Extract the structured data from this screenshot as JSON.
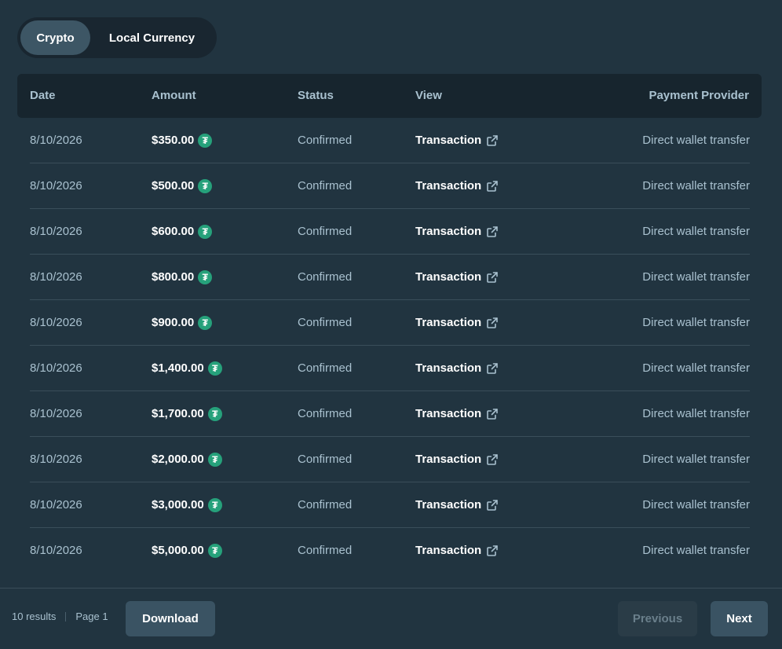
{
  "tabs": {
    "crypto": "Crypto",
    "local": "Local Currency"
  },
  "columns": {
    "date": "Date",
    "amount": "Amount",
    "status": "Status",
    "view": "View",
    "provider": "Payment Provider"
  },
  "rows": [
    {
      "date": "8/10/2026",
      "amount": "$350.00",
      "status": "Confirmed",
      "view": "Transaction",
      "provider": "Direct wallet transfer"
    },
    {
      "date": "8/10/2026",
      "amount": "$500.00",
      "status": "Confirmed",
      "view": "Transaction",
      "provider": "Direct wallet transfer"
    },
    {
      "date": "8/10/2026",
      "amount": "$600.00",
      "status": "Confirmed",
      "view": "Transaction",
      "provider": "Direct wallet transfer"
    },
    {
      "date": "8/10/2026",
      "amount": "$800.00",
      "status": "Confirmed",
      "view": "Transaction",
      "provider": "Direct wallet transfer"
    },
    {
      "date": "8/10/2026",
      "amount": "$900.00",
      "status": "Confirmed",
      "view": "Transaction",
      "provider": "Direct wallet transfer"
    },
    {
      "date": "8/10/2026",
      "amount": "$1,400.00",
      "status": "Confirmed",
      "view": "Transaction",
      "provider": "Direct wallet transfer"
    },
    {
      "date": "8/10/2026",
      "amount": "$1,700.00",
      "status": "Confirmed",
      "view": "Transaction",
      "provider": "Direct wallet transfer"
    },
    {
      "date": "8/10/2026",
      "amount": "$2,000.00",
      "status": "Confirmed",
      "view": "Transaction",
      "provider": "Direct wallet transfer"
    },
    {
      "date": "8/10/2026",
      "amount": "$3,000.00",
      "status": "Confirmed",
      "view": "Transaction",
      "provider": "Direct wallet transfer"
    },
    {
      "date": "8/10/2026",
      "amount": "$5,000.00",
      "status": "Confirmed",
      "view": "Transaction",
      "provider": "Direct wallet transfer"
    }
  ],
  "currency_icon": "tether-icon",
  "currency_icon_color": "#26a17b",
  "footer": {
    "results": "10 results",
    "page": "Page 1",
    "download": "Download",
    "previous": "Previous",
    "next": "Next"
  }
}
